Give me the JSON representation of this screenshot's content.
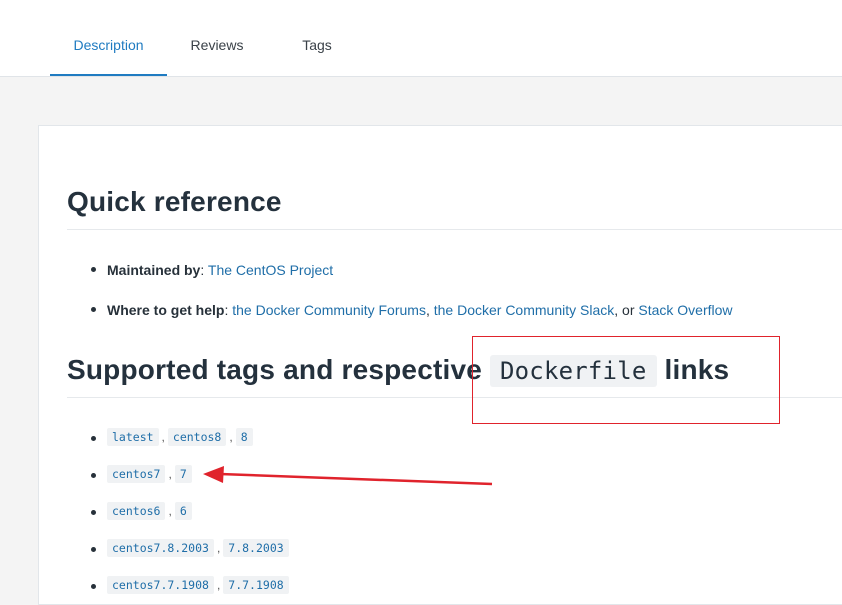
{
  "tabs": [
    {
      "label": "Description",
      "active": true
    },
    {
      "label": "Reviews",
      "active": false
    },
    {
      "label": "Tags",
      "active": false
    }
  ],
  "quick_reference": {
    "title": "Quick reference",
    "maintained_label": "Maintained by",
    "maintained_link": "The CentOS Project",
    "help_label": "Where to get help",
    "help_link_1": "the Docker Community Forums",
    "help_link_2": "the Docker Community Slack",
    "help_or": "or",
    "help_link_3": "Stack Overflow"
  },
  "supported_tags": {
    "title_prefix": "Supported tags and respective",
    "title_code": "Dockerfile",
    "title_suffix": "links",
    "rows": [
      [
        "latest",
        "centos8",
        "8"
      ],
      [
        "centos7",
        "7"
      ],
      [
        "centos6",
        "6"
      ],
      [
        "centos7.8.2003",
        "7.8.2003"
      ],
      [
        "centos7.7.1908",
        "7.7.1908"
      ]
    ]
  },
  "colors": {
    "accent": "#1f7bc1",
    "link": "#1f6ea8",
    "annotation": "#e0232c"
  }
}
